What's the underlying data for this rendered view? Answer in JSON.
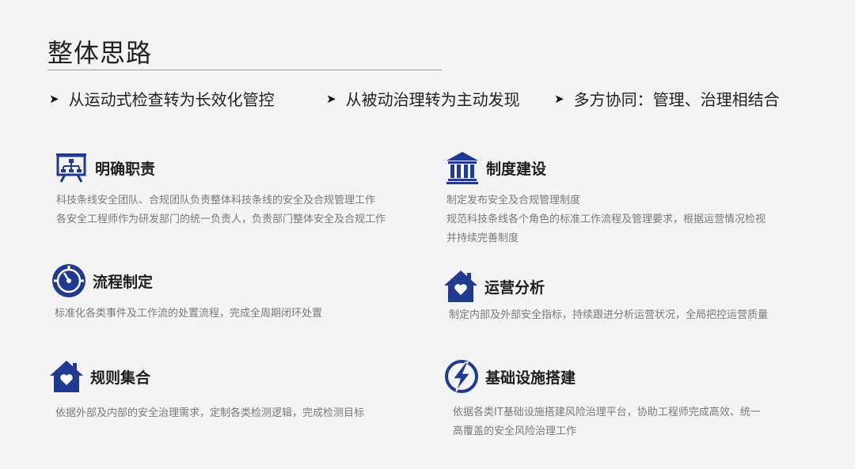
{
  "page": {
    "title": "整体思路",
    "accent_color": "#1f3a8f"
  },
  "principles": [
    {
      "arrow": "➤",
      "text": "从运动式检查转为长效化管控"
    },
    {
      "arrow": "➤",
      "text": "从被动治理转为主动发现"
    },
    {
      "arrow": "➤",
      "text": "多方协同：管理、治理相结合"
    }
  ],
  "cards": [
    {
      "icon": "presentation-board-icon",
      "heading": "明确职责",
      "lines": [
        "科技条线安全团队、合规团队负责整体科技条线的安全及合规管理工作",
        "各安全工程师作为研发部门的统一负责人，负责部门整体安全及合规工作"
      ]
    },
    {
      "icon": "bank-building-icon",
      "heading": "制度建设",
      "lines": [
        "制定发布安全及合规管理制度",
        "规范科技条线各个角色的标准工作流程及管理要求，根据运营情况检视",
        "并持续完善制度"
      ]
    },
    {
      "icon": "gauge-dial-icon",
      "heading": "流程制定",
      "lines": [
        "标准化各类事件及工作流的处置流程，完成全周期闭环处置"
      ]
    },
    {
      "icon": "house-heart-icon",
      "heading": "运营分析",
      "lines": [
        "制定内部及外部安全指标，持续跟进分析运营状况，全局把控运营质量"
      ]
    },
    {
      "icon": "house-heart-icon",
      "heading": "规则集合",
      "lines": [
        "依据外部及内部的安全治理需求，定制各类检测逻辑，完成检测目标"
      ]
    },
    {
      "icon": "lightning-bolt-icon",
      "heading": "基础设施搭建",
      "lines": [
        "依据各类IT基础设施搭建风险治理平台，协助工程师完成高效、统一",
        "高覆盖的安全风险治理工作"
      ]
    }
  ]
}
